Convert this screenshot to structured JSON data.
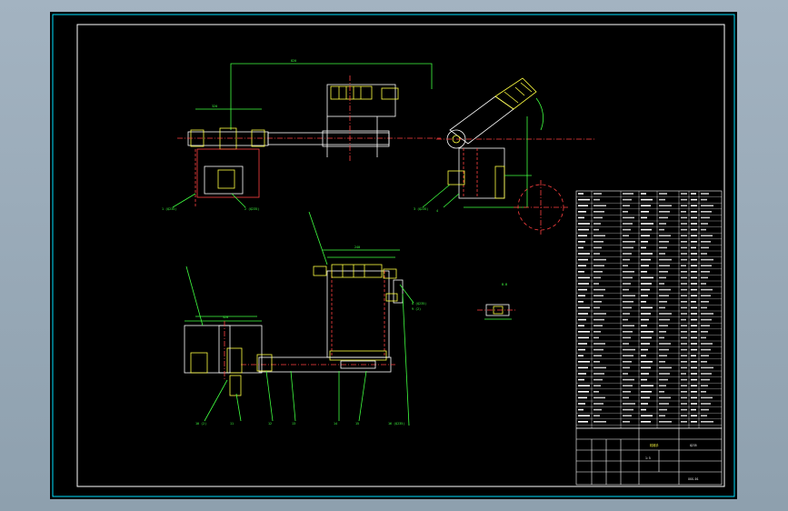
{
  "colors": {
    "background": "#000000",
    "frame": "#00e0ff",
    "geometry": "#ffffff",
    "dimensions": "#40ff40",
    "hidden": "#ff4040",
    "highlight": "#ffff40"
  },
  "callouts": {
    "top_left_a": "1 (Q235)",
    "top_left_b": "2 (Q235)",
    "mid_right_a": "8 (Q235)",
    "mid_right_b": "9 (2)",
    "lower_a": "10 (2)",
    "lower_b": "11",
    "lower_c": "12",
    "lower_d": "13",
    "lower_e": "14",
    "lower_f": "15",
    "lower_g": "16 (Q235)",
    "section_label": "B-B"
  },
  "title_block": {
    "title_main": "机械手",
    "title_code": "XXX-01",
    "material": "Q235",
    "scale": "1:5"
  }
}
